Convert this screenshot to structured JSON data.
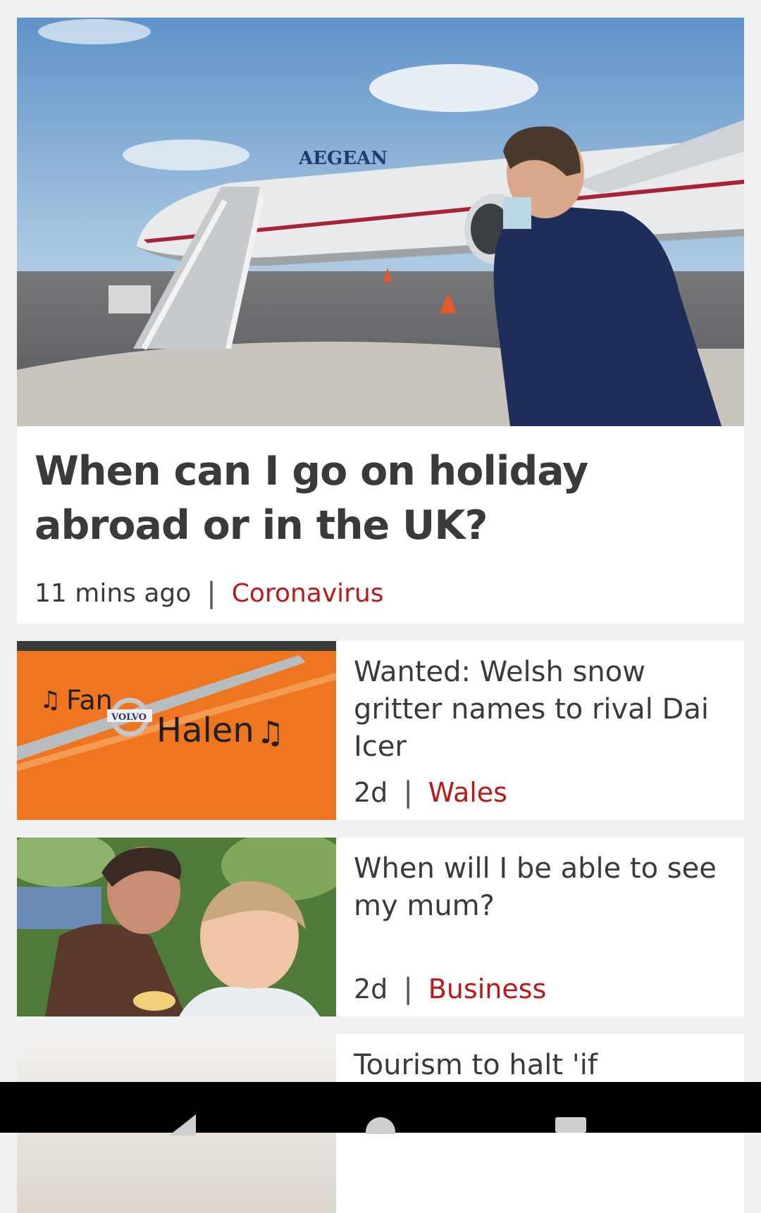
{
  "articles": {
    "hero": {
      "title": "When can I go on holiday abroad or in the UK?",
      "time": "11 mins ago",
      "separator": "|",
      "topic": "Coronavirus",
      "image_text": "AEGEAN"
    },
    "items": [
      {
        "title": "Wanted: Welsh snow gritter names to rival Dai Icer",
        "time": "2d",
        "separator": "|",
        "topic": "Wales",
        "image_text_1": "Fan",
        "image_text_2": "Halen",
        "image_badge": "VOLVO"
      },
      {
        "title": "When will I be able to see my mum?",
        "time": "2d",
        "separator": "|",
        "topic": "Business"
      },
      {
        "title": "Tourism to halt 'if"
      }
    ]
  },
  "colors": {
    "topic": "#bb1919",
    "text": "#3a3a3a",
    "background": "#f1f1f1"
  },
  "navigation": {
    "icons": [
      "back-icon",
      "home-icon",
      "recents-icon"
    ]
  }
}
